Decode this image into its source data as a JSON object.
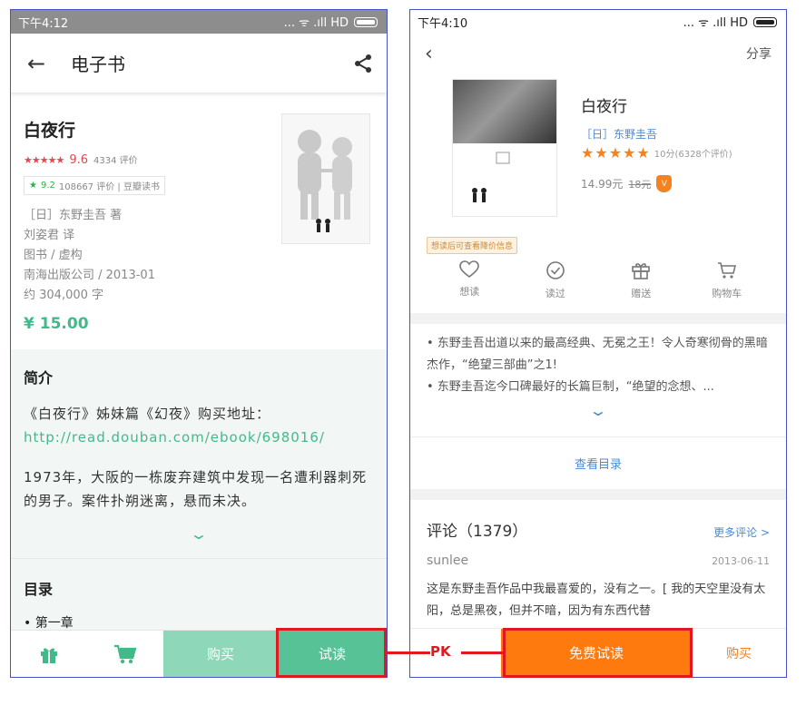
{
  "left": {
    "status": {
      "time": "下午4:12",
      "signal": "... ᯤ .ıll HD"
    },
    "appbar": {
      "title": "电子书"
    },
    "book": {
      "title": "白夜行",
      "stars": "★★★★★",
      "score": "9.6",
      "rating_count": "4334 评价",
      "douban_score": "9.2",
      "douban_text": "108667 评价 | 豆瓣读书",
      "meta": [
        "［日］东野圭吾 著",
        "刘姿君 译",
        "图书 / 虚构",
        "南海出版公司 / 2013-01",
        "约 304,000 字"
      ],
      "price": "¥ 15.00"
    },
    "intro": {
      "heading": "简介",
      "line_prefix": "《白夜行》姊妹篇《幻夜》购买地址：",
      "link": "http://read.douban.com/ebook/698016/",
      "text": "1973年，大阪的一栋废弃建筑中发现一名遭利器刺死的男子。案件扑朔迷离，悬而未决。"
    },
    "toc": {
      "heading": "目录",
      "first": "• 第一章"
    },
    "bottom": {
      "buy": "购买",
      "trial": "试读"
    }
  },
  "right": {
    "status": {
      "time": "下午4:10",
      "signal": "... ᯤ .ıll HD"
    },
    "nav": {
      "back": "‹",
      "share": "分享"
    },
    "book": {
      "title": "白夜行",
      "author": "［日］东野圭吾",
      "stars": "★★★★★",
      "rating_text": "10分(6328个评价)",
      "price": "14.99元",
      "old_price": "18元",
      "vip": "V",
      "tag": "想读后可查看降价信息"
    },
    "actions": [
      {
        "icon": "heart-icon",
        "label": "想读"
      },
      {
        "icon": "check-circle-icon",
        "label": "读过"
      },
      {
        "icon": "gift-icon",
        "label": "赠送"
      },
      {
        "icon": "cart-icon",
        "label": "购物车"
      }
    ],
    "desc": [
      "• 东野圭吾出道以来的最高经典、无冕之王！令人奇寒彻骨的黑暗杰作，“绝望三部曲”之1!",
      "• 东野圭吾迄今口碑最好的长篇巨制，“绝望的念想、..."
    ],
    "toc": "查看目录",
    "reviews": {
      "title": "评论（1379）",
      "more": "更多评论 >",
      "user": "sunlee",
      "date": "2013-06-11",
      "text": "这是东野圭吾作品中我最喜爱的，没有之一。[ 我的天空里没有太阳，总是黑夜，但并不暗，因为有东西代替"
    },
    "bottom": {
      "trial": "免费试读",
      "buy": "购买"
    }
  },
  "compare_label": "PK",
  "colors": {
    "green": "#43b98a",
    "orange": "#ff7a0e",
    "highlight": "#e0181f",
    "frame": "#4a52c8"
  }
}
